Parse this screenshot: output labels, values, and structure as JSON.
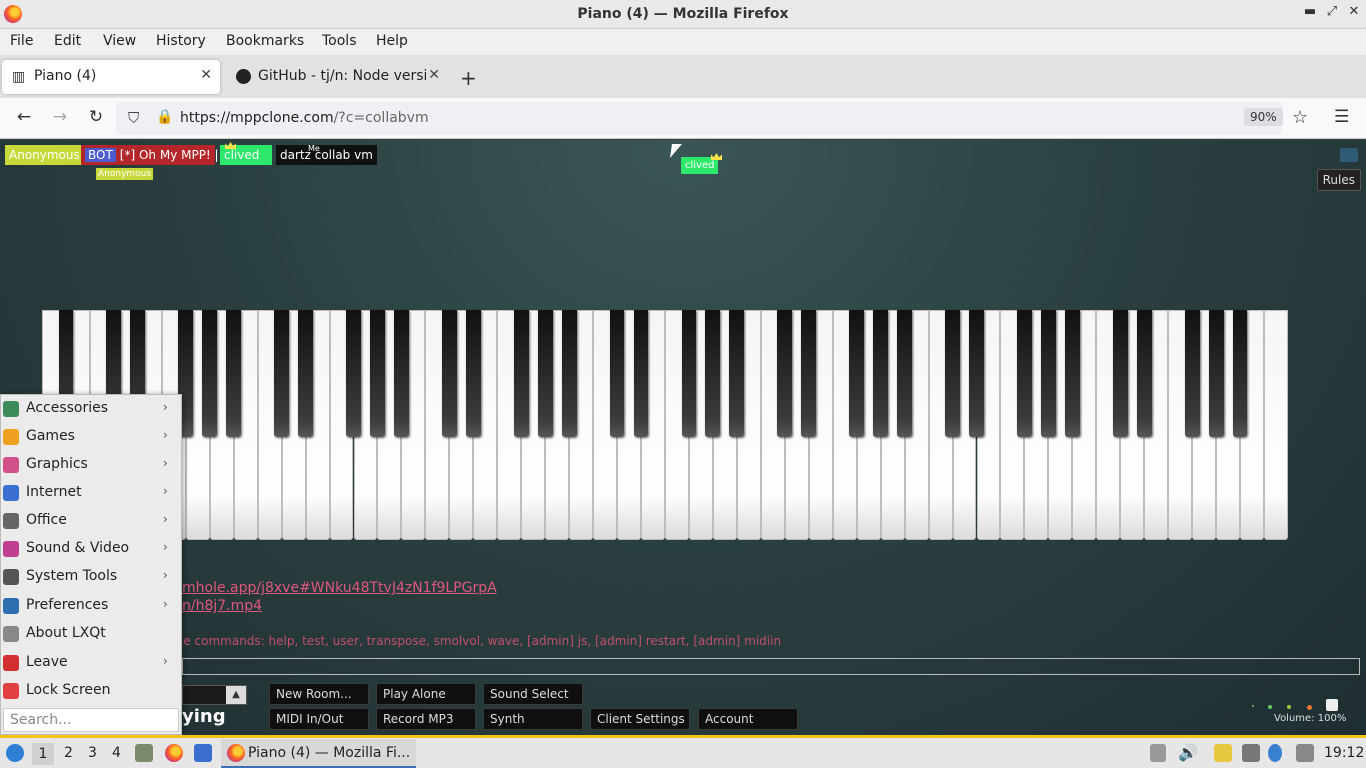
{
  "window": {
    "title": "Piano (4) — Mozilla Firefox",
    "minimize_glyph": "▬",
    "maximize_glyph": "⤢",
    "close_glyph": "✕"
  },
  "menubar": [
    "File",
    "Edit",
    "View",
    "History",
    "Bookmarks",
    "Tools",
    "Help"
  ],
  "tabs": [
    {
      "label": "Piano (4)",
      "icon": "piano-icon",
      "active": true
    },
    {
      "label": "GitHub - tj/n: Node versi",
      "icon": "github-icon",
      "active": false
    }
  ],
  "tab_close_glyph": "✕",
  "new_tab_glyph": "+",
  "navbar": {
    "back_glyph": "←",
    "forward_glyph": "→",
    "reload_glyph": "↻",
    "url_host": "https://mppclone.com",
    "url_rest": "/?c=collabvm",
    "zoom": "90%",
    "star_glyph": "☆",
    "menu_glyph": "☰"
  },
  "page": {
    "users": [
      {
        "name": "Anonymous",
        "bg": "#c7d93a",
        "fg": "#ffffff"
      },
      {
        "name": "[*] Oh My MPP! | A",
        "tag": "BOT",
        "bg": "#b3262a",
        "fg": "#ffffff"
      },
      {
        "name": "clived",
        "bg": "#2ee86c",
        "fg": "#ffffff",
        "crown": true
      },
      {
        "name": "dartz collab vm",
        "bg": "#111111",
        "fg": "#ffffff",
        "me_label": "Me"
      }
    ],
    "hover_label": "Anonymous",
    "floating_cursor_label": "clived",
    "rules_label": "Rules",
    "chat": [
      "mhole.app/j8xve#WNku48TtvJ4zN1f9LPGrpA",
      "n/h8j7.mp4"
    ],
    "chat_commands": "le commands: help, test, user, transpose, smolvol, wave, [admin] js, [admin] restart, [admin] midiin",
    "buttons_row1": [
      "New Room...",
      "Play Alone",
      "Sound Select"
    ],
    "buttons_row2": [
      "MIDI In/Out",
      "Record MP3",
      "Synth",
      "Client Settings",
      "Account"
    ],
    "playing_label": "ying",
    "volume": "Volume: 100%"
  },
  "start_menu": {
    "items": [
      {
        "label": "Accessories",
        "icon": "accessories-icon",
        "color": "#3d8a5a",
        "submenu": true
      },
      {
        "label": "Games",
        "icon": "games-icon",
        "color": "#f0a020",
        "submenu": true
      },
      {
        "label": "Graphics",
        "icon": "graphics-icon",
        "color": "#d0508a",
        "submenu": true
      },
      {
        "label": "Internet",
        "icon": "internet-icon",
        "color": "#3a6fd0",
        "submenu": true
      },
      {
        "label": "Office",
        "icon": "office-icon",
        "color": "#666666",
        "submenu": true
      },
      {
        "label": "Sound & Video",
        "icon": "sound-video-icon",
        "color": "#c04090",
        "submenu": true
      },
      {
        "label": "System Tools",
        "icon": "system-tools-icon",
        "color": "#555555",
        "submenu": true
      },
      {
        "label": "Preferences",
        "icon": "preferences-icon",
        "color": "#2f6fb0",
        "submenu": true
      },
      {
        "label": "About LXQt",
        "icon": "about-icon",
        "color": "#888888",
        "submenu": false
      },
      {
        "label": "Leave",
        "icon": "leave-icon",
        "color": "#d03030",
        "submenu": true
      },
      {
        "label": "Lock Screen",
        "icon": "lock-screen-icon",
        "color": "#e04040",
        "submenu": false
      }
    ],
    "submenu_glyph": "›",
    "search_placeholder": "Search..."
  },
  "taskbar": {
    "desktops": [
      "1",
      "2",
      "3",
      "4"
    ],
    "task_label": "Piano (4) — Mozilla Fi...",
    "clock": "19:12"
  },
  "colors": {
    "accent": "#f0c419",
    "link": "#e0577e"
  }
}
